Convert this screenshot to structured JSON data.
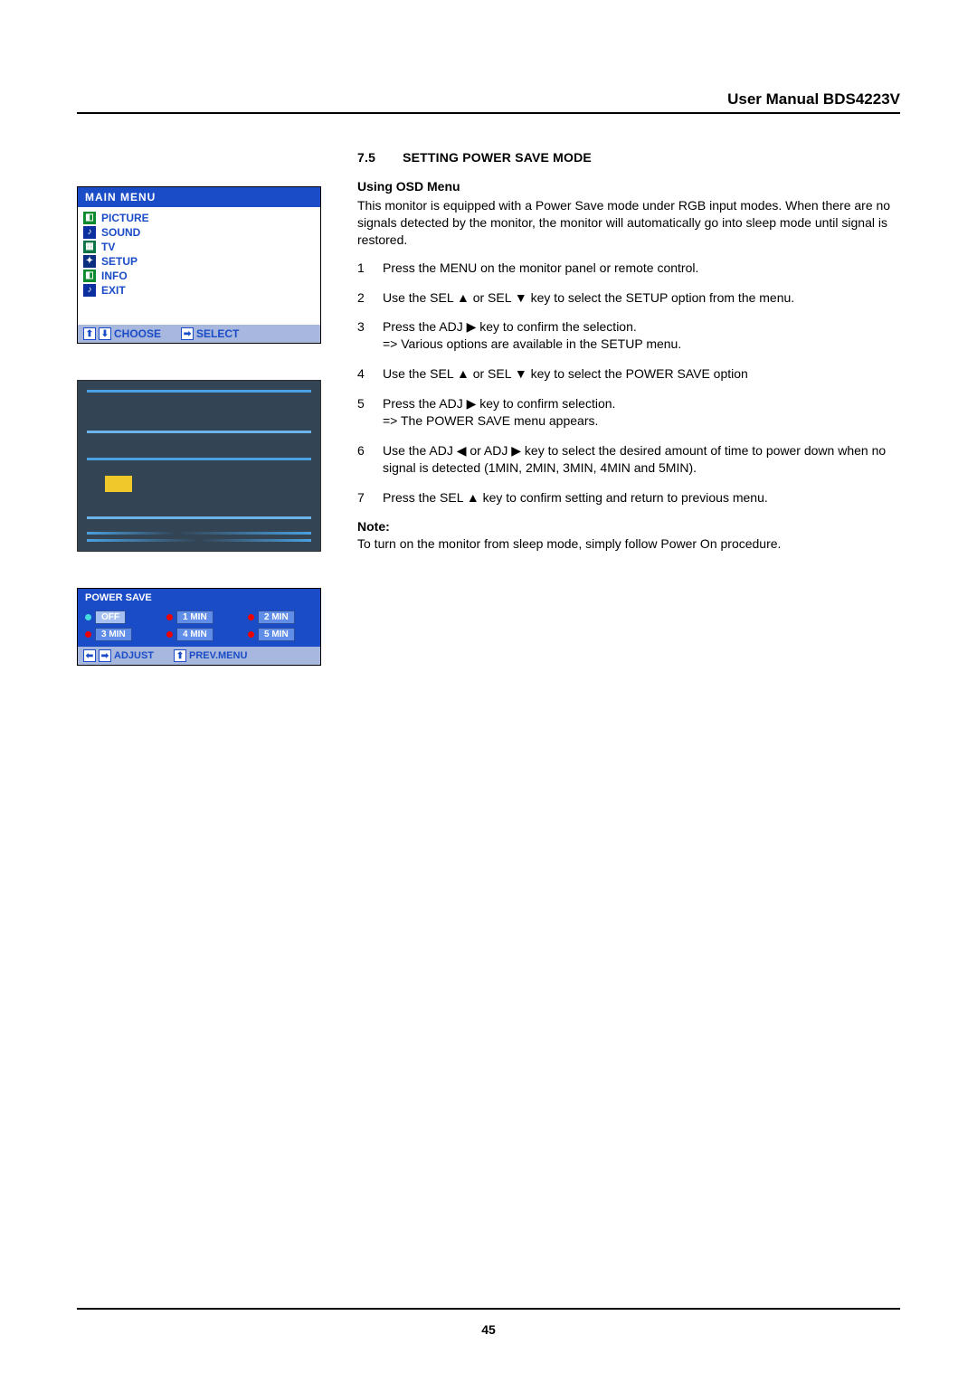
{
  "header": {
    "title": "User Manual BDS4223V"
  },
  "page_number": "45",
  "main_menu": {
    "title": "MAIN  MENU",
    "items": [
      "PICTURE",
      "SOUND",
      "TV",
      "SETUP",
      "INFO",
      "EXIT"
    ],
    "footer_choose": "CHOOSE",
    "footer_select": "SELECT"
  },
  "power_save": {
    "title": "POWER  SAVE",
    "options": [
      {
        "label": "OFF",
        "selected": true
      },
      {
        "label": "1 MIN",
        "selected": false
      },
      {
        "label": "2 MIN",
        "selected": false
      },
      {
        "label": "3 MIN",
        "selected": false
      },
      {
        "label": "4 MIN",
        "selected": false
      },
      {
        "label": "5 MIN",
        "selected": false
      }
    ],
    "footer_adjust": "ADJUST",
    "footer_prev": "PREV.MENU"
  },
  "section": {
    "num": "7.5",
    "title": "SETTING POWER SAVE MODE",
    "subhead": "Using OSD Menu",
    "intro": "This monitor is equipped with a Power Save mode under RGB input modes. When there are no signals detected by the monitor, the monitor will automatically go into sleep mode until signal is restored.",
    "steps": [
      "Press the MENU on the monitor panel or remote control.",
      "Use the SEL ▲ or SEL ▼ key to select the SETUP option from the menu.",
      "Press the ADJ ▶ key to confirm the selection.\n=> Various options are available in the SETUP menu.",
      "Use the SEL ▲ or SEL ▼ key to select the POWER SAVE option",
      "Press the ADJ ▶ key to confirm selection.\n=> The POWER SAVE menu appears.",
      "Use the ADJ ◀ or ADJ ▶  key to select the desired amount of time to power down when no signal is detected (1MIN, 2MIN, 3MIN, 4MIN and 5MIN).",
      "Press the SEL ▲  key to confirm setting and return to previous menu."
    ],
    "note_label": "Note:",
    "note_text": "To turn on the monitor from sleep mode, simply follow Power On procedure."
  }
}
